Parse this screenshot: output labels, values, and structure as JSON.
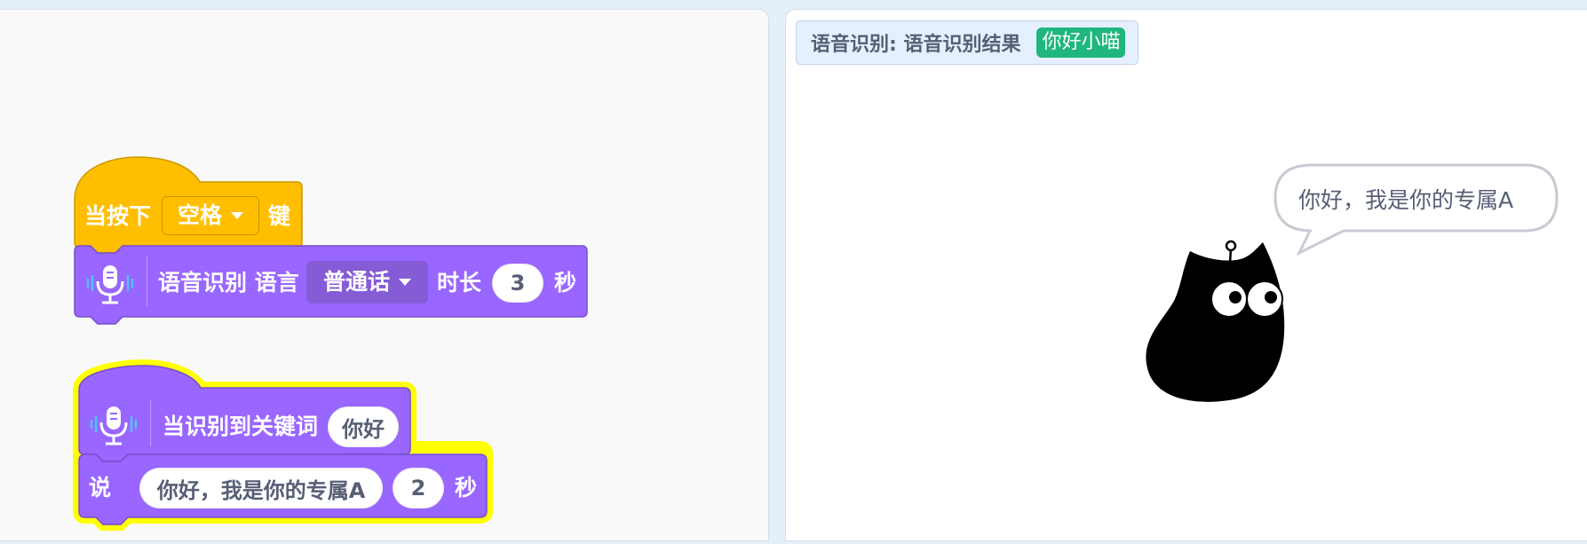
{
  "code_area": {
    "hat_block": {
      "prefix": "当按下",
      "key_dropdown": "空格",
      "suffix": "键"
    },
    "speech_block": {
      "label_1": "语音识别 语言",
      "language_dropdown": "普通话",
      "label_2": "时长",
      "duration": "3",
      "unit": "秒"
    },
    "keyword_hat": {
      "label": "当识别到关键词",
      "keyword": "你好"
    },
    "say_block": {
      "label": "说",
      "message": "你好，我是你的专属A",
      "seconds": "2",
      "unit": "秒"
    }
  },
  "stage": {
    "monitor": {
      "label": "语音识别: 语音识别结果",
      "value": "你好小喵"
    },
    "speech_bubble": "你好，我是你的专属A"
  },
  "colors": {
    "events_block": "#ffbf00",
    "extension_block": "#9966ff",
    "highlight_glow": "#ffff00",
    "monitor_value": "#1fb77d"
  },
  "icons": [
    "microphone-icon",
    "dropdown-caret-icon"
  ]
}
